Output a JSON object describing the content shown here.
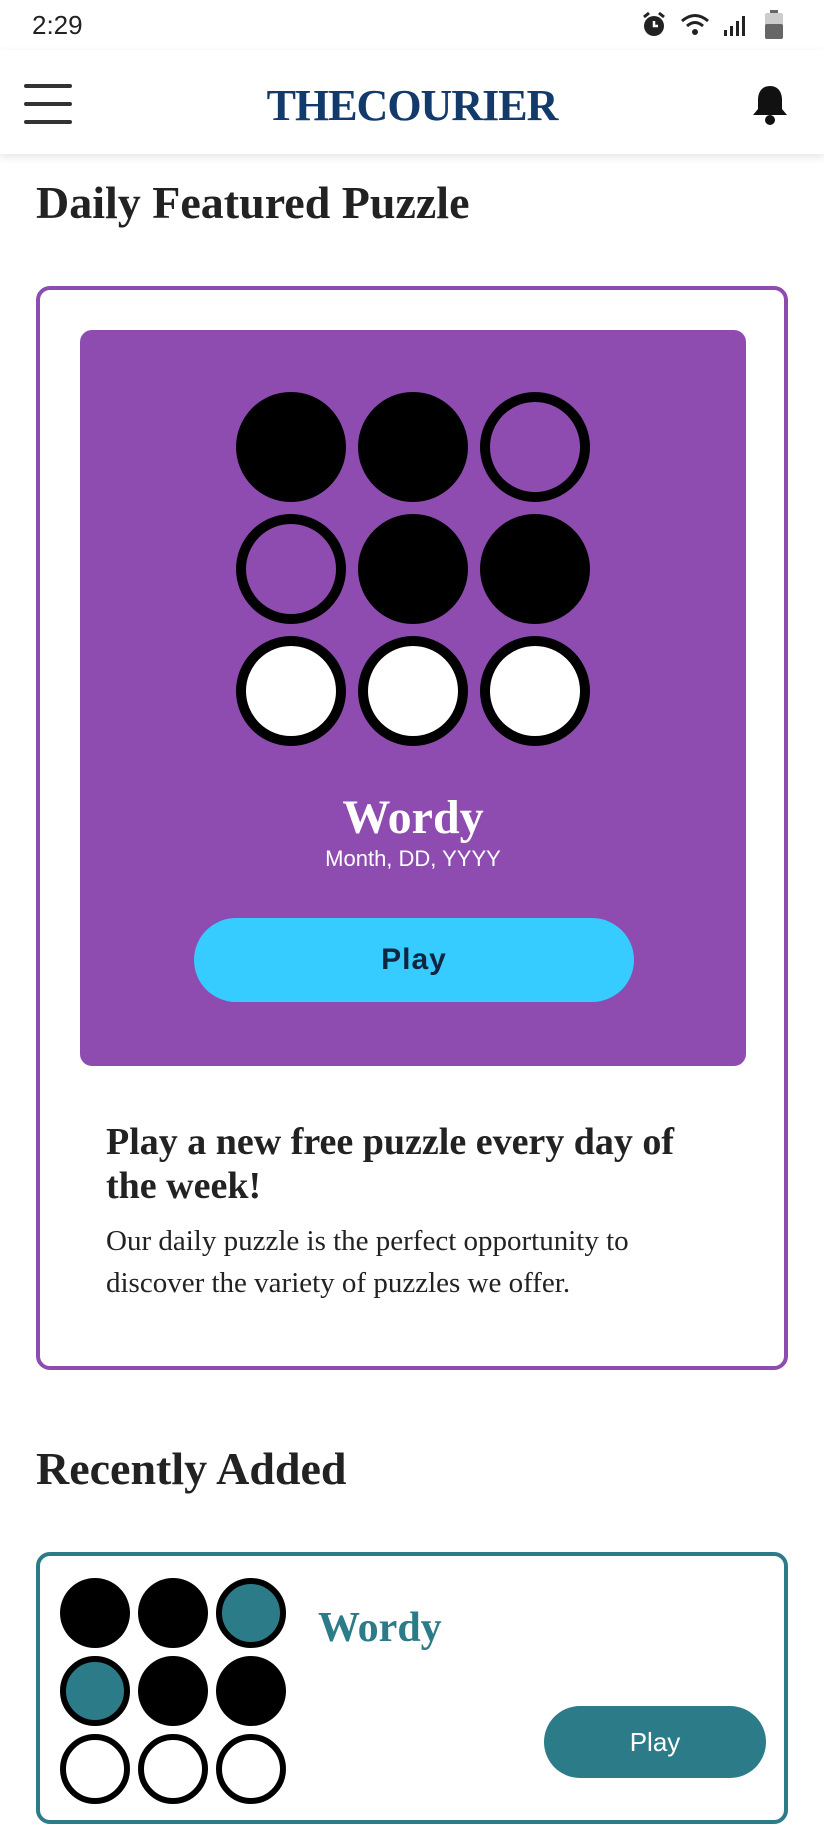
{
  "status_bar": {
    "time": "2:29",
    "icons": [
      "alarm-icon",
      "wifi-icon",
      "signal-icon",
      "battery-icon"
    ]
  },
  "header": {
    "brand": "THECOURIER",
    "menu_icon": "hamburger-menu-icon",
    "notification_icon": "bell-icon",
    "brand_color": "#123a6b"
  },
  "featured": {
    "section_title": "Daily Featured Puzzle",
    "puzzle": {
      "name": "Wordy",
      "date": "Month, DD, YYYY",
      "play_label": "Play",
      "grid": [
        "filled",
        "filled",
        "hollow",
        "hollow",
        "filled",
        "filled",
        "white",
        "white",
        "white"
      ]
    },
    "promo_heading": "Play a new free puzzle every day of the week!",
    "promo_body": "Our daily puzzle is the perfect opportunity to discover the variety of puzzles we offer.",
    "accent_color": "#8e4cb0",
    "button_color": "#36ccff"
  },
  "recent": {
    "section_title": "Recently Added",
    "items": [
      {
        "name": "Wordy",
        "play_label": "Play",
        "grid": [
          "filled",
          "filled",
          "teal",
          "teal",
          "filled",
          "filled",
          "white",
          "white",
          "white"
        ]
      }
    ],
    "accent_color": "#2b7c88"
  }
}
